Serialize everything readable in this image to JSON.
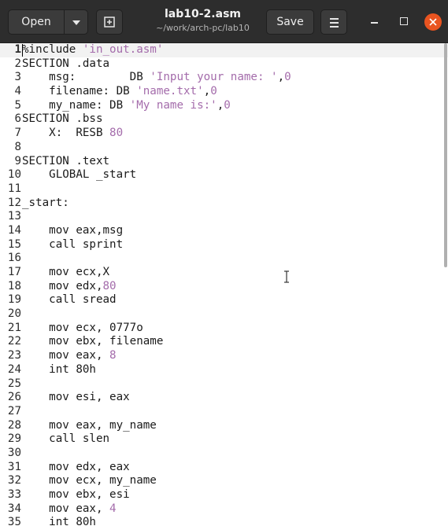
{
  "header": {
    "open_label": "Open",
    "save_label": "Save",
    "title": "lab10-2.asm",
    "subtitle": "~/work/arch-pc/lab10"
  },
  "icons": {
    "open_menu": "chevron-down-icon",
    "new_tab": "new-tab-icon",
    "menu": "hamburger-menu-icon",
    "minimize": "minimize-icon",
    "maximize": "maximize-icon",
    "close": "close-icon"
  },
  "colors": {
    "headerbar": "#2d2d2d",
    "close": "#e95420",
    "string": "#a46cab",
    "current_line": "#f2f2f2"
  },
  "editor": {
    "current_line": 1,
    "lines": [
      {
        "n": "1",
        "segs": [
          {
            "t": "%include ",
            "c": "txt"
          },
          {
            "t": "'in_out.asm'",
            "c": "str"
          }
        ]
      },
      {
        "n": "2",
        "segs": [
          {
            "t": "SECTION .data",
            "c": "txt"
          }
        ]
      },
      {
        "n": "3",
        "segs": [
          {
            "t": "    msg:        DB ",
            "c": "txt"
          },
          {
            "t": "'Input your name: '",
            "c": "str"
          },
          {
            "t": ",",
            "c": "txt"
          },
          {
            "t": "0",
            "c": "num"
          }
        ]
      },
      {
        "n": "4",
        "segs": [
          {
            "t": "    filename: DB ",
            "c": "txt"
          },
          {
            "t": "'name.txt'",
            "c": "str"
          },
          {
            "t": ",",
            "c": "txt"
          },
          {
            "t": "0",
            "c": "num"
          }
        ]
      },
      {
        "n": "5",
        "segs": [
          {
            "t": "    my_name: DB ",
            "c": "txt"
          },
          {
            "t": "'My name is:'",
            "c": "str"
          },
          {
            "t": ",",
            "c": "txt"
          },
          {
            "t": "0",
            "c": "num"
          }
        ]
      },
      {
        "n": "6",
        "segs": [
          {
            "t": "SECTION .bss",
            "c": "txt"
          }
        ]
      },
      {
        "n": "7",
        "segs": [
          {
            "t": "    X:  RESB ",
            "c": "txt"
          },
          {
            "t": "80",
            "c": "num"
          }
        ]
      },
      {
        "n": "8",
        "segs": []
      },
      {
        "n": "9",
        "segs": [
          {
            "t": "SECTION .text",
            "c": "txt"
          }
        ]
      },
      {
        "n": "10",
        "segs": [
          {
            "t": "    GLOBAL _start",
            "c": "txt"
          }
        ]
      },
      {
        "n": "11",
        "segs": []
      },
      {
        "n": "12",
        "segs": [
          {
            "t": "_start:",
            "c": "txt"
          }
        ]
      },
      {
        "n": "13",
        "segs": []
      },
      {
        "n": "14",
        "segs": [
          {
            "t": "    mov eax,msg",
            "c": "txt"
          }
        ]
      },
      {
        "n": "15",
        "segs": [
          {
            "t": "    call sprint",
            "c": "txt"
          }
        ]
      },
      {
        "n": "16",
        "segs": []
      },
      {
        "n": "17",
        "segs": [
          {
            "t": "    mov ecx,X",
            "c": "txt"
          }
        ]
      },
      {
        "n": "18",
        "segs": [
          {
            "t": "    mov edx,",
            "c": "txt"
          },
          {
            "t": "80",
            "c": "num"
          }
        ]
      },
      {
        "n": "19",
        "segs": [
          {
            "t": "    call sread",
            "c": "txt"
          }
        ]
      },
      {
        "n": "20",
        "segs": []
      },
      {
        "n": "21",
        "segs": [
          {
            "t": "    mov ecx, 0777o",
            "c": "txt"
          }
        ]
      },
      {
        "n": "22",
        "segs": [
          {
            "t": "    mov ebx, filename",
            "c": "txt"
          }
        ]
      },
      {
        "n": "23",
        "segs": [
          {
            "t": "    mov eax, ",
            "c": "txt"
          },
          {
            "t": "8",
            "c": "num"
          }
        ]
      },
      {
        "n": "24",
        "segs": [
          {
            "t": "    int 80h",
            "c": "txt"
          }
        ]
      },
      {
        "n": "25",
        "segs": []
      },
      {
        "n": "26",
        "segs": [
          {
            "t": "    mov esi, eax",
            "c": "txt"
          }
        ]
      },
      {
        "n": "27",
        "segs": []
      },
      {
        "n": "28",
        "segs": [
          {
            "t": "    mov eax, my_name",
            "c": "txt"
          }
        ]
      },
      {
        "n": "29",
        "segs": [
          {
            "t": "    call slen",
            "c": "txt"
          }
        ]
      },
      {
        "n": "30",
        "segs": []
      },
      {
        "n": "31",
        "segs": [
          {
            "t": "    mov edx, eax",
            "c": "txt"
          }
        ]
      },
      {
        "n": "32",
        "segs": [
          {
            "t": "    mov ecx, my_name",
            "c": "txt"
          }
        ]
      },
      {
        "n": "33",
        "segs": [
          {
            "t": "    mov ebx, esi",
            "c": "txt"
          }
        ]
      },
      {
        "n": "34",
        "segs": [
          {
            "t": "    mov eax, ",
            "c": "txt"
          },
          {
            "t": "4",
            "c": "num"
          }
        ]
      },
      {
        "n": "35",
        "segs": [
          {
            "t": "    int 80h",
            "c": "txt"
          }
        ]
      }
    ]
  }
}
